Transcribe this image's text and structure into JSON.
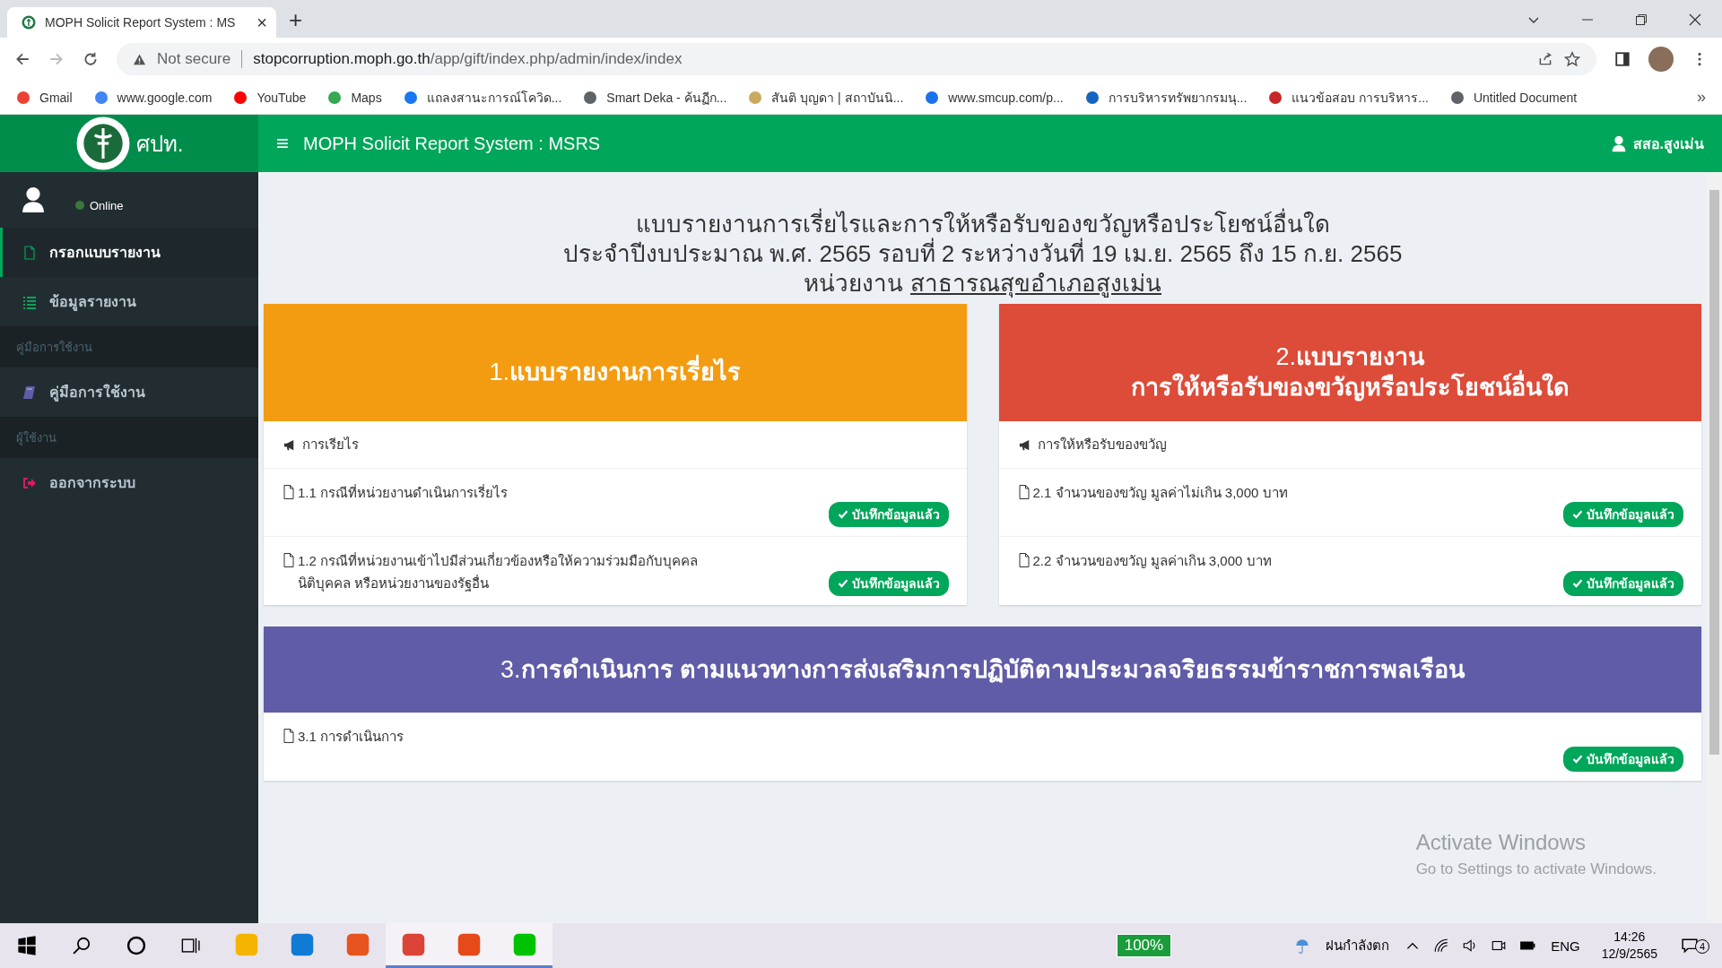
{
  "browser": {
    "tab_title": "MOPH Solicit Report System : MS",
    "tab_close": "×",
    "new_tab": "+",
    "url_warning": "Not secure",
    "url_host": "stopcorruption.moph.go.th",
    "url_path": "/app/gift/index.php/admin/index/index",
    "bookmarks": [
      "Gmail",
      "www.google.com",
      "YouTube",
      "Maps",
      "แถลงสานะการณ์โควิด...",
      "Smart Deka - ค้นฏีก...",
      "สันติ บุญดา | สถาบันนิ...",
      "www.smcup.com/p...",
      "การบริหารทรัพยากรมนุ...",
      "แนวข้อสอบ การบริหาร...",
      "Untitled Document"
    ],
    "more": "»"
  },
  "header": {
    "logo_text": "ศปท.",
    "menu_glyph": "≡",
    "title": "MOPH Solicit Report System : MSRS",
    "user": "สสอ.สูงเม่น"
  },
  "sidebar": {
    "status": "Online",
    "items": [
      {
        "kind": "link",
        "label": "กรอกแบบรายงาน",
        "selected": true
      },
      {
        "kind": "link",
        "label": "ข้อมูลรายงาน",
        "selected": false
      },
      {
        "kind": "header",
        "label": "คู่มือการใช้งาน"
      },
      {
        "kind": "link",
        "label": "คู่มือการใช้งาน",
        "selected": false
      },
      {
        "kind": "header",
        "label": "ผู้ใช้งาน"
      },
      {
        "kind": "link",
        "label": "ออกจากระบบ",
        "selected": false
      }
    ]
  },
  "page": {
    "heading": [
      "แบบรายงานการเรี่ยไรและการให้หรือรับของขวัญหรือประโยชน์อื่นใด",
      "ประจำปีงบประมาณ พ.ศ. 2565 รอบที่ 2 ระหว่างวันที่ 19 เม.ย. 2565 ถึง 15 ก.ย. 2565"
    ],
    "unit_label": "หน่วยงาน",
    "unit_link": "สาธารณสุขอำเภอสูงเม่น",
    "section_rows": [
      [
        {
          "title": "1.**แบบรายงานการเรี่ยไร**",
          "color": "#f39c12",
          "subheading": "การเรียไร",
          "items": [
            {
              "text": "1.1 กรณีที่หน่วยงานดำเนินการเรี่ยไร",
              "status": "บันทึกข้อมูลแล้ว"
            },
            {
              "text": "1.2 กรณีที่หน่วยงานเข้าไปมีส่วนเกี่ยวข้องหรือให้ความร่วมมือกับบุคคล นิติบุคคล หรือหน่วยงานของรัฐอื่น",
              "status": "บันทึกข้อมูลแล้ว"
            }
          ]
        },
        {
          "title": "2.**แบบรายงาน**",
          "title_line2": "การให้หรือรับของขวัญหรือประโยชน์อื่นใด",
          "color": "#dd4b39",
          "subheading": "การให้หรือรับของขวัญ",
          "items": [
            {
              "text": "2.1 จำนวนของขวัญ มูลค่าไม่เกิน 3,000 บาท",
              "status": "บันทึกข้อมูลแล้ว"
            },
            {
              "text": "2.2 จำนวนของขวัญ มูลค่าเกิน 3,000 บาท",
              "status": "บันทึกข้อมูลแล้ว"
            }
          ]
        }
      ],
      [
        {
          "title": "3.**การดำเนินการ ตามแนวทางการส่งเสริมการปฏิบัติตามประมวลจริยธรรมข้าราชการพลเรือน**",
          "color": "#605ca8",
          "items": [
            {
              "text": "3.1 การดำเนินการ",
              "status": "บันทึกข้อมูลแล้ว"
            }
          ]
        }
      ]
    ]
  },
  "watermark": {
    "title": "Activate Windows",
    "subtitle": "Go to Settings to activate Windows."
  },
  "taskbar": {
    "apps": [
      {
        "running": false
      },
      {
        "running": false
      },
      {
        "running": false
      },
      {
        "running": true
      },
      {
        "running": true
      },
      {
        "running": true
      }
    ],
    "battery": "100%",
    "weather": "ฝนกำลังตก",
    "language": "ENG",
    "time": "14:26",
    "date": "12/9/2565",
    "notifications": "4"
  }
}
